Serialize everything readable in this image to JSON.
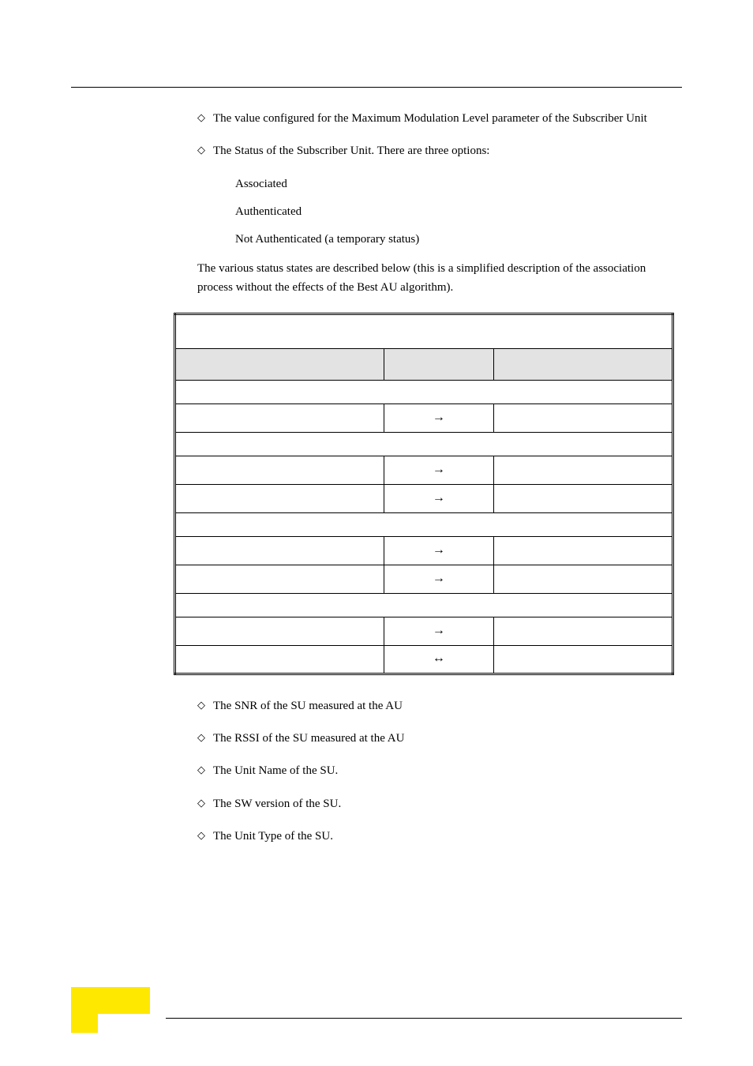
{
  "bullets_top": [
    "The value configured for the Maximum Modulation Level parameter of the Subscriber Unit",
    "The Status of the Subscriber Unit. There are three options:"
  ],
  "status_options": [
    "Associated",
    "Authenticated",
    "Not Authenticated (a temporary status)"
  ],
  "paragraph": "The various status states are described below (this is a simplified description of the association process without the effects of the Best AU algorithm).",
  "table": {
    "title_row": "",
    "header": [
      "",
      "",
      ""
    ],
    "rows": [
      {
        "type": "section",
        "cells": [
          ""
        ]
      },
      {
        "type": "data",
        "cells": [
          "",
          "→",
          ""
        ]
      },
      {
        "type": "section",
        "cells": [
          ""
        ]
      },
      {
        "type": "data",
        "cells": [
          "",
          "→",
          ""
        ]
      },
      {
        "type": "data",
        "cells": [
          "",
          "→",
          ""
        ]
      },
      {
        "type": "section",
        "cells": [
          ""
        ]
      },
      {
        "type": "data",
        "cells": [
          "",
          "→",
          ""
        ]
      },
      {
        "type": "data",
        "cells": [
          "",
          "→",
          ""
        ]
      },
      {
        "type": "section",
        "cells": [
          ""
        ]
      },
      {
        "type": "data",
        "cells": [
          "",
          "→",
          ""
        ]
      },
      {
        "type": "data",
        "cells": [
          "",
          "↔",
          ""
        ]
      }
    ]
  },
  "bullets_bottom": [
    "The SNR of the SU measured at the AU",
    "The RSSI of the SU measured at the AU",
    "The Unit Name of the SU.",
    "The SW version of the SU.",
    "The Unit Type of the SU."
  ],
  "glyphs": {
    "diamond": "◇"
  }
}
